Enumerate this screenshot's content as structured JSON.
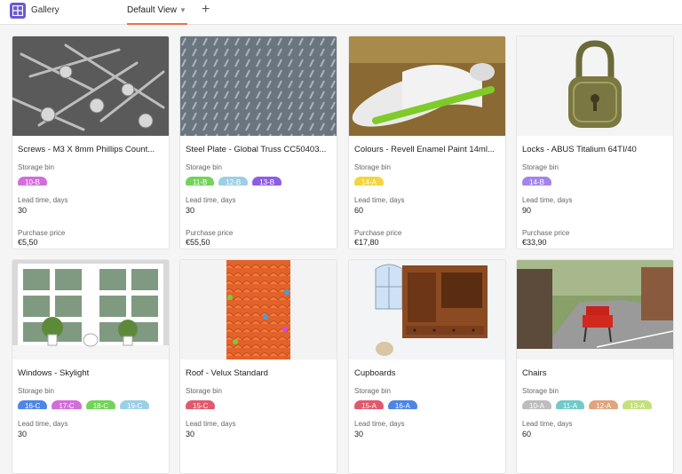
{
  "app": {
    "title": "Gallery",
    "view_name": "Default View",
    "add_icon": "plus-icon"
  },
  "labels": {
    "storage": "Storage bin",
    "lead": "Lead time, days",
    "price": "Purchase price"
  },
  "colors": {
    "accent": "#e8734a",
    "brand": "#6a5acd",
    "pink": "#d36ddb",
    "green": "#72d35a",
    "lightblue": "#9ccfe6",
    "purple": "#8e5de4",
    "yellow": "#f4d43d",
    "lavender": "#a284ea",
    "blue": "#4e86e6",
    "red": "#e05a6d",
    "gray": "#bdbdbd",
    "teal": "#6fcac9",
    "tan": "#e0a57e",
    "lime": "#c3e07a"
  },
  "cards": [
    {
      "title": "Screws - M3 X 8mm Phillips Count...",
      "bins": [
        {
          "label": "10-B",
          "color": "#d36ddb"
        }
      ],
      "lead": "30",
      "price": "€5,50"
    },
    {
      "title": "Steel Plate - Global Truss CC50403...",
      "bins": [
        {
          "label": "11-B",
          "color": "#72d35a"
        },
        {
          "label": "12-B",
          "color": "#9ccfe6"
        },
        {
          "label": "13-B",
          "color": "#8e5de4"
        }
      ],
      "lead": "30",
      "price": "€55,50"
    },
    {
      "title": "Colours - Revell Enamel Paint 14ml...",
      "bins": [
        {
          "label": "14-A",
          "color": "#f4d43d"
        }
      ],
      "lead": "60",
      "price": "€17,80"
    },
    {
      "title": "Locks - ABUS Titalium 64TI/40",
      "bins": [
        {
          "label": "14-B",
          "color": "#a284ea"
        }
      ],
      "lead": "90",
      "price": "€33,90"
    },
    {
      "title": "Windows - Skylight",
      "bins": [
        {
          "label": "16-C",
          "color": "#4e86e6"
        },
        {
          "label": "17-C",
          "color": "#d36ddb"
        },
        {
          "label": "18-C",
          "color": "#72d35a"
        },
        {
          "label": "19-C",
          "color": "#9ccfe6"
        }
      ],
      "lead": "30",
      "price": ""
    },
    {
      "title": "Roof - Velux Standard",
      "bins": [
        {
          "label": "15-C",
          "color": "#e05a6d"
        }
      ],
      "lead": "30",
      "price": ""
    },
    {
      "title": "Cupboards",
      "bins": [
        {
          "label": "15-A",
          "color": "#e05a6d"
        },
        {
          "label": "16-A",
          "color": "#4e86e6"
        }
      ],
      "lead": "30",
      "price": ""
    },
    {
      "title": "Chairs",
      "bins": [
        {
          "label": "10-A",
          "color": "#bdbdbd"
        },
        {
          "label": "11-A",
          "color": "#6fcac9"
        },
        {
          "label": "12-A",
          "color": "#e0a57e"
        },
        {
          "label": "13-A",
          "color": "#c3e07a"
        }
      ],
      "lead": "60",
      "price": ""
    }
  ]
}
